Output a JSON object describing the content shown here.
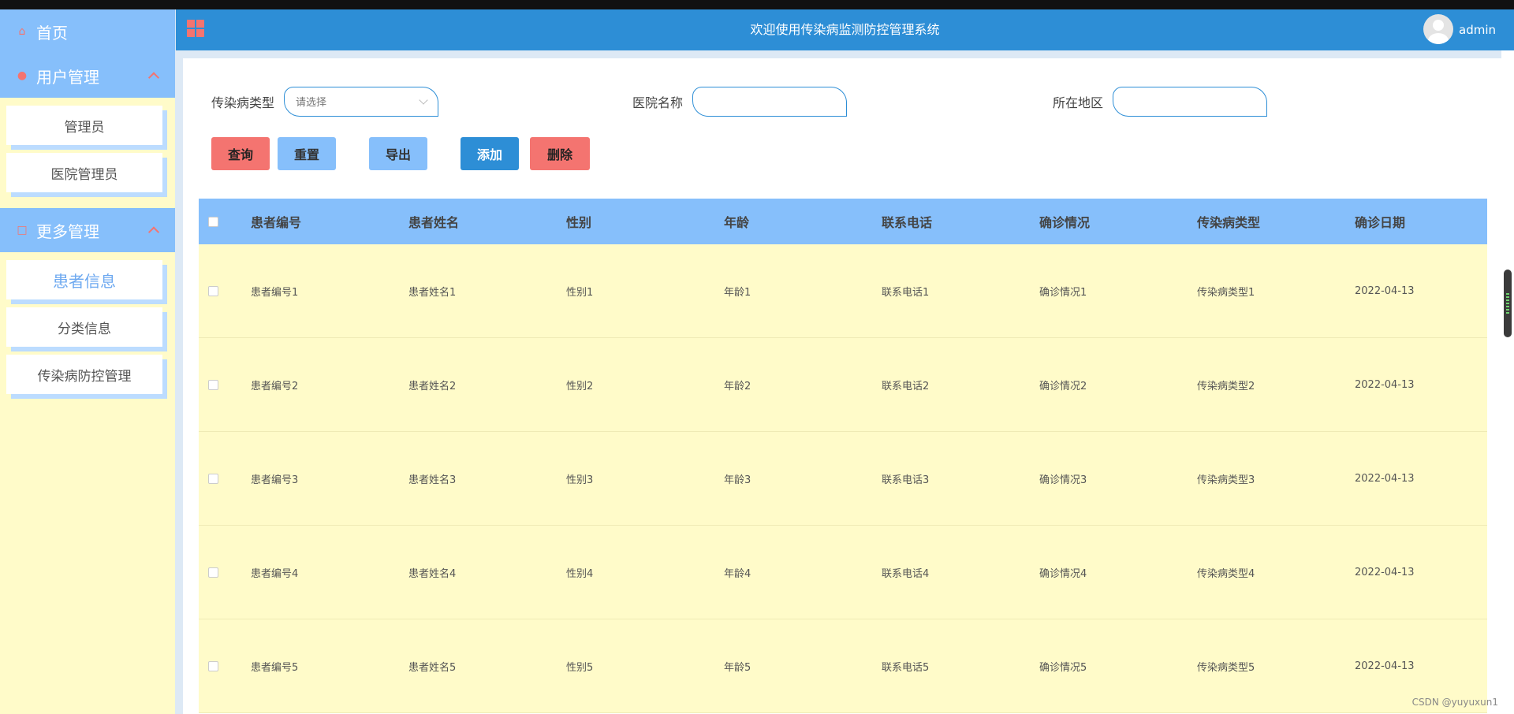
{
  "header": {
    "title": "欢迎使用传染病监测防控管理系统",
    "username": "admin"
  },
  "sidebar": {
    "home": "首页",
    "user_mgmt": {
      "label": "用户管理",
      "items": [
        "管理员",
        "医院管理员"
      ]
    },
    "more_mgmt": {
      "label": "更多管理",
      "items": [
        "患者信息",
        "分类信息",
        "传染病防控管理"
      ],
      "active_index": 0
    }
  },
  "search": {
    "disease_type_label": "传染病类型",
    "disease_type_placeholder": "请选择",
    "hospital_label": "医院名称",
    "hospital_value": "",
    "region_label": "所在地区",
    "region_value": ""
  },
  "buttons": {
    "query": "查询",
    "reset": "重置",
    "export": "导出",
    "add": "添加",
    "delete": "删除"
  },
  "table": {
    "columns": [
      "患者编号",
      "患者姓名",
      "性别",
      "年龄",
      "联系电话",
      "确诊情况",
      "传染病类型",
      "确诊日期"
    ],
    "rows": [
      [
        "患者编号1",
        "患者姓名1",
        "性别1",
        "年龄1",
        "联系电话1",
        "确诊情况1",
        "传染病类型1",
        "2022-04-13"
      ],
      [
        "患者编号2",
        "患者姓名2",
        "性别2",
        "年龄2",
        "联系电话2",
        "确诊情况2",
        "传染病类型2",
        "2022-04-13"
      ],
      [
        "患者编号3",
        "患者姓名3",
        "性别3",
        "年龄3",
        "联系电话3",
        "确诊情况3",
        "传染病类型3",
        "2022-04-13"
      ],
      [
        "患者编号4",
        "患者姓名4",
        "性别4",
        "年龄4",
        "联系电话4",
        "确诊情况4",
        "传染病类型4",
        "2022-04-13"
      ],
      [
        "患者编号5",
        "患者姓名5",
        "性别5",
        "年龄5",
        "联系电话5",
        "确诊情况5",
        "传染病类型5",
        "2022-04-13"
      ]
    ]
  },
  "watermark": "CSDN @yuyuxun1",
  "colors": {
    "header_bg": "#2d8ed6",
    "sidebar_accent": "#86bffb",
    "sidebar_bg": "#fffbc9",
    "danger": "#f47470"
  }
}
